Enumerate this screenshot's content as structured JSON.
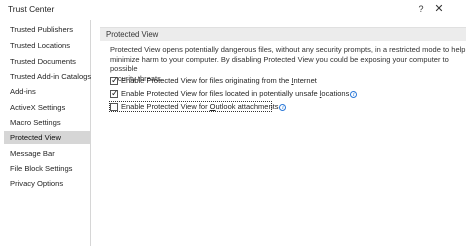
{
  "window": {
    "title": "Trust Center",
    "help_glyph": "?",
    "close_glyph": "✕"
  },
  "sidebar": {
    "items": [
      {
        "label": "Trusted Publishers",
        "active": false
      },
      {
        "label": "Trusted Locations",
        "active": false
      },
      {
        "label": "Trusted Documents",
        "active": false
      },
      {
        "label": "Trusted Add-in Catalogs",
        "active": false
      },
      {
        "label": "Add-ins",
        "active": false
      },
      {
        "label": "ActiveX Settings",
        "active": false
      },
      {
        "label": "Macro Settings",
        "active": false
      },
      {
        "label": "Protected View",
        "active": true
      },
      {
        "label": "Message Bar",
        "active": false
      },
      {
        "label": "File Block Settings",
        "active": false
      },
      {
        "label": "Privacy Options",
        "active": false
      }
    ]
  },
  "main": {
    "section_title": "Protected View",
    "description_lines": [
      "Protected View opens potentially dangerous files, without any security prompts, in a restricted mode to help",
      "minimize harm to your computer. By disabling Protected View you could be exposing your computer to possible",
      "security threats."
    ],
    "options": [
      {
        "pre": "Enable Protected View for files originating from the ",
        "accel": "I",
        "post": "nternet",
        "checked": true,
        "info": false
      },
      {
        "pre": "Enable Protected View for files located in potentially unsafe ",
        "accel": "l",
        "post": "ocations",
        "checked": true,
        "info": true
      },
      {
        "pre": "Enable Protected View for ",
        "accel": "O",
        "post": "utlook attachments",
        "checked": false,
        "info": true
      }
    ]
  },
  "icons": {
    "info_icon": "info-icon",
    "info_color": "#2b79d8"
  }
}
